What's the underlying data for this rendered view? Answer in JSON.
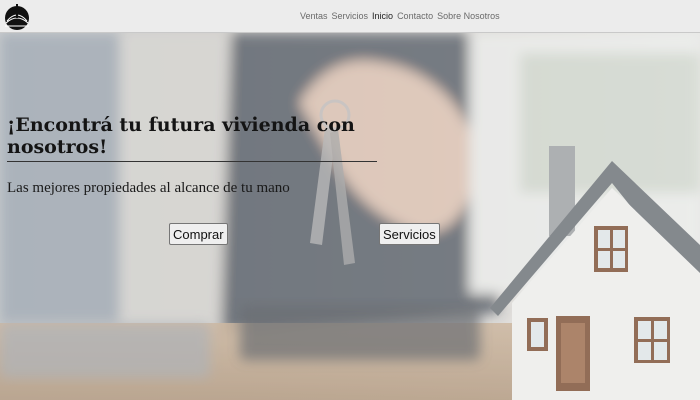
{
  "nav": {
    "items": [
      {
        "label": "Ventas"
      },
      {
        "label": "Servicios"
      },
      {
        "label": "Inicio"
      },
      {
        "label": "Contacto"
      },
      {
        "label": "Sobre Nosotros"
      }
    ],
    "active_index": 2
  },
  "hero": {
    "headline": "¡Encontrá tu futura vivienda con nosotros!",
    "subtitle": "Las mejores propiedades al alcance de tu mano",
    "buttons": {
      "comprar_label": "Comprar",
      "servicios_label": "Servicios"
    }
  },
  "colors": {
    "navbar_bg": "#ececec",
    "nav_text": "#6a6a6a",
    "nav_active": "#222222",
    "button_bg": "#efefef"
  },
  "icons": {
    "logo": "house-drawing-logo-icon"
  }
}
